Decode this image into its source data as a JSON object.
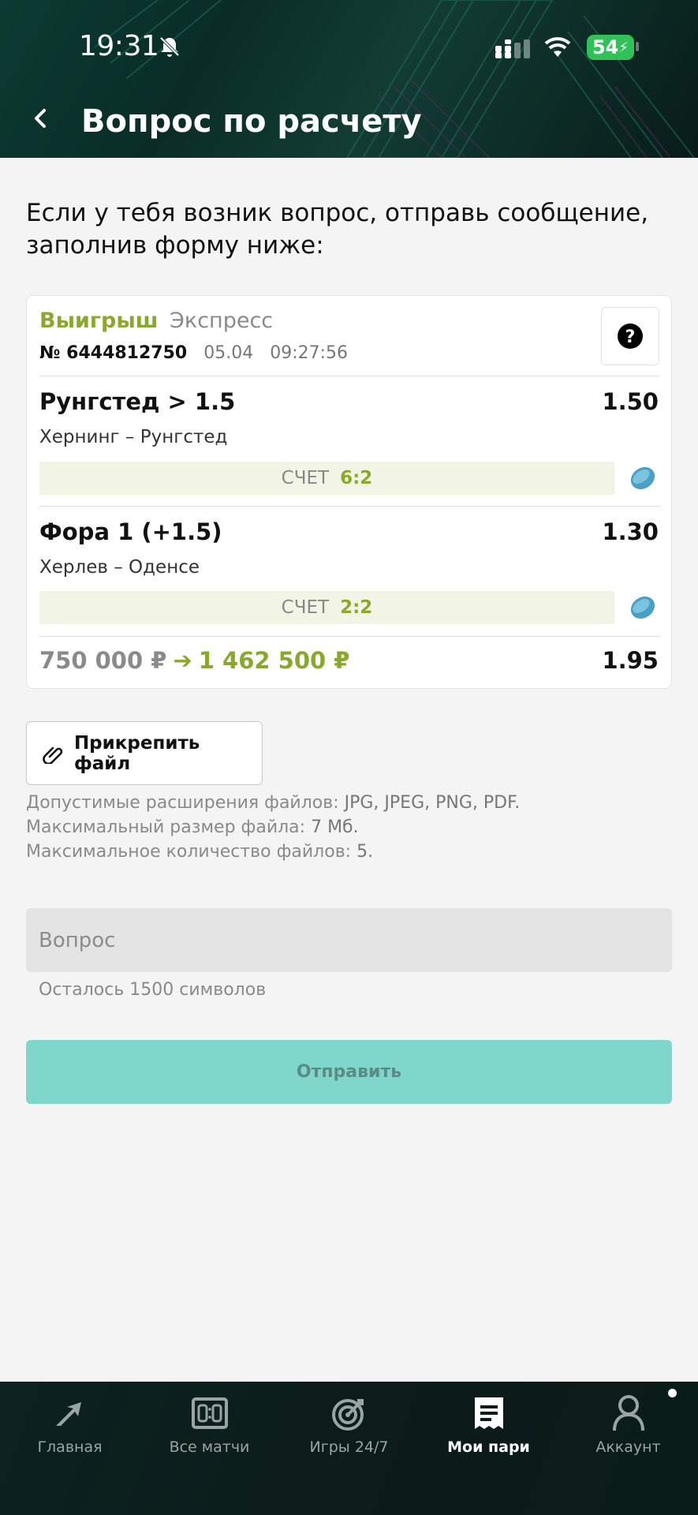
{
  "status_bar": {
    "time": "19:31",
    "battery": "54"
  },
  "header": {
    "title": "Вопрос по расчету"
  },
  "intro": {
    "text": "Если у тебя возник вопрос, отправь сообщение, заполнив форму ниже:"
  },
  "bet_card": {
    "result": "Выигрыш",
    "type": "Экспресс",
    "number_prefix": "№",
    "number": "6444812750",
    "date": "05.04",
    "time": "09:27:56",
    "events": [
      {
        "name": "Рунгстед > 1.5",
        "odds": "1.50",
        "match": "Хернинг – Рунгстед",
        "score_label": "СЧЕТ",
        "score": "6:2"
      },
      {
        "name": "Фора 1 (+1.5)",
        "odds": "1.30",
        "match": "Херлев – Оденсе",
        "score_label": "СЧЕТ",
        "score": "2:2"
      }
    ],
    "stake": "750 000 ₽",
    "arrow": "➔",
    "payout": "1 462 500 ₽",
    "total_odds": "1.95"
  },
  "attach": {
    "label": "Прикрепить файл",
    "rule1_prefix": "Допустимые расширения файлов: ",
    "rule1_value": "JPG, JPEG, PNG, PDF.",
    "rule2_prefix": "Максимальный размер файла: ",
    "rule2_value": "7 Мб.",
    "rule3_prefix": "Максимальное количество файлов: ",
    "rule3_value": "5."
  },
  "question": {
    "placeholder": "Вопрос",
    "remaining": "Осталось 1500 символов"
  },
  "submit": {
    "label": "Отправить"
  },
  "bottom_nav": {
    "items": [
      {
        "label": "Главная",
        "icon": "home-arrow-icon"
      },
      {
        "label": "Все матчи",
        "icon": "scoreboard-icon"
      },
      {
        "label": "Игры 24/7",
        "icon": "target-icon"
      },
      {
        "label": "Мои пари",
        "icon": "receipt-icon"
      },
      {
        "label": "Аккаунт",
        "icon": "user-icon"
      }
    ]
  },
  "colors": {
    "accent_green": "#8aa82b",
    "submit_teal": "#7fd7cb",
    "header_dark": "#0b3b32"
  }
}
